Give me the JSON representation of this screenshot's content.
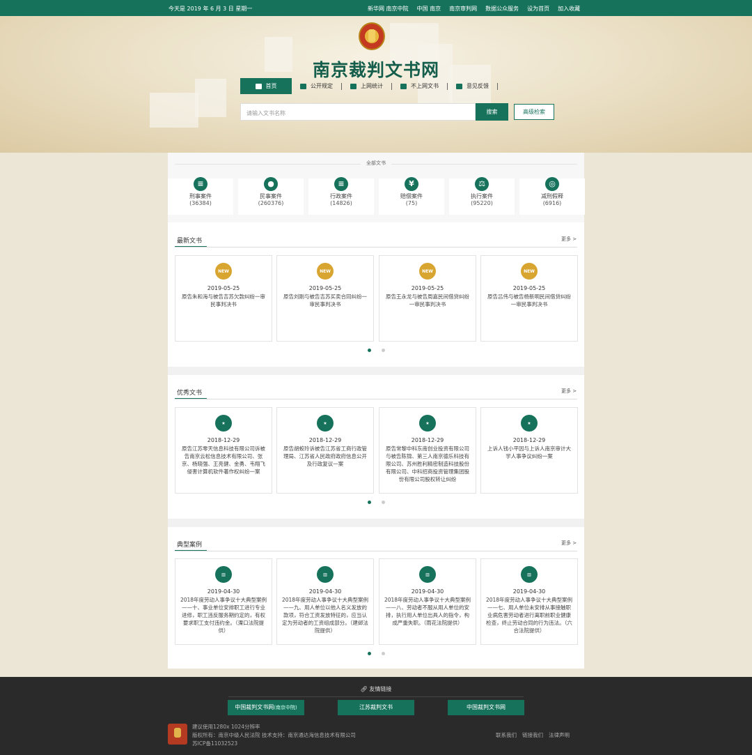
{
  "topbar": {
    "date": "今天是 2019 年 6 月 3 日 星期一",
    "links": [
      "新华网 南京中院",
      "中国 南京",
      "南京审判网",
      "数据公众服务",
      "设为首页",
      "加入收藏"
    ]
  },
  "header": {
    "site_title": "南京裁判文书网",
    "nav": [
      "首页",
      "公开规定",
      "上网统计",
      "不上网文书",
      "意见反馈"
    ],
    "search_placeholder": "请输入文书名称",
    "search_button": "搜索",
    "advanced_button": "高级检索"
  },
  "categories": {
    "label": "全部文书",
    "items": [
      {
        "name": "刑事案件",
        "count": "(36384)",
        "icon": "books-star-icon"
      },
      {
        "name": "民事案件",
        "count": "(260376)",
        "icon": "person-icon"
      },
      {
        "name": "行政案件",
        "count": "(14826)",
        "icon": "books-star-icon"
      },
      {
        "name": "赔偿案件",
        "count": "(75)",
        "icon": "yen-icon"
      },
      {
        "name": "执行案件",
        "count": "(95220)",
        "icon": "gavel-icon"
      },
      {
        "name": "减刑假释",
        "count": "(6916)",
        "icon": "magnifier-person-icon"
      }
    ]
  },
  "latest": {
    "title": "最新文书",
    "more": "更多 >",
    "badge": "NEW",
    "cards": [
      {
        "date": "2019-05-25",
        "text": "原告朱和海与被告吉苏欠款纠纷一审民事判决书"
      },
      {
        "date": "2019-05-25",
        "text": "原告刘刚与被告吉苏买卖合同纠纷一审民事判决书"
      },
      {
        "date": "2019-05-25",
        "text": "原告王永龙与被告周嘉民间借贷纠纷一审民事判决书"
      },
      {
        "date": "2019-05-25",
        "text": "原告吕伟与被告杨新明民间借贷纠纷一审民事判决书"
      }
    ]
  },
  "excellent": {
    "title": "优秀文书",
    "more": "更多 >",
    "cards": [
      {
        "date": "2018-12-29",
        "text": "原告江苏零天信息科技有限公司诉被告南京云松信息技术有限公司、张京、杨晓强、王亮健、金勇、韦翔飞侵害计算机软件著作权纠纷一案"
      },
      {
        "date": "2018-12-29",
        "text": "原告胡蛟玲诉被告江苏省工商行政管理局、江苏省人民政府政府信息公开及行政复议一案"
      },
      {
        "date": "2018-12-29",
        "text": "原告常黎中科东南创业投资有限公司与被告陈锦、第三人南京德乐科技有限公司、苏州胜利精密制造科技股份有限公司、中科招商投资管理集团股份有限公司股权转让纠纷"
      },
      {
        "date": "2018-12-29",
        "text": "上诉人钱小平因与上诉人南京审计大学人事争议纠纷一案"
      }
    ]
  },
  "typical": {
    "title": "典型案例",
    "more": "更多 >",
    "cards": [
      {
        "date": "2019-04-30",
        "text": "2018年度劳动人事争议十大典型案例——十、事业单位安排职工进行专业进修，职工违反服务期约定的，有权要求职工支付违约金。（溧口法院提供）"
      },
      {
        "date": "2019-04-30",
        "text": "2018年度劳动人事争议十大典型案例——九、用人单位以他人名义发放的款项，符合工资发放特征的，应当认定为劳动者的工资组成部分。（建邺法院提供）"
      },
      {
        "date": "2019-04-30",
        "text": "2018年度劳动人事争议十大典型案例——八、劳动者不服从用人单位的安排，执行用人单位出具人的指令，构成严重失职。（雨花法院提供）"
      },
      {
        "date": "2019-04-30",
        "text": "2018年度劳动人事争议十大典型案例——七、用人单位未安排从事接触职业病危害劳动者进行离职前职业健康检查，终止劳动合同的行为违法。（六合法院提供）"
      }
    ]
  },
  "footer": {
    "links_title": "友情链接",
    "btn1": "中国裁判文书网",
    "btn1_sub": "(南京中院)",
    "btn2": "江苏裁判文书",
    "btn3": "中国裁判文书网",
    "line1": "建议使用1280x 1024分辨率",
    "line2": "版权所有：南京中级人民法院 技术支持：南京通达海信息技术有限公司",
    "line3": "苏ICP备11032523",
    "bottom_links": [
      "联系我们",
      "链接我们",
      "法律声明"
    ]
  }
}
